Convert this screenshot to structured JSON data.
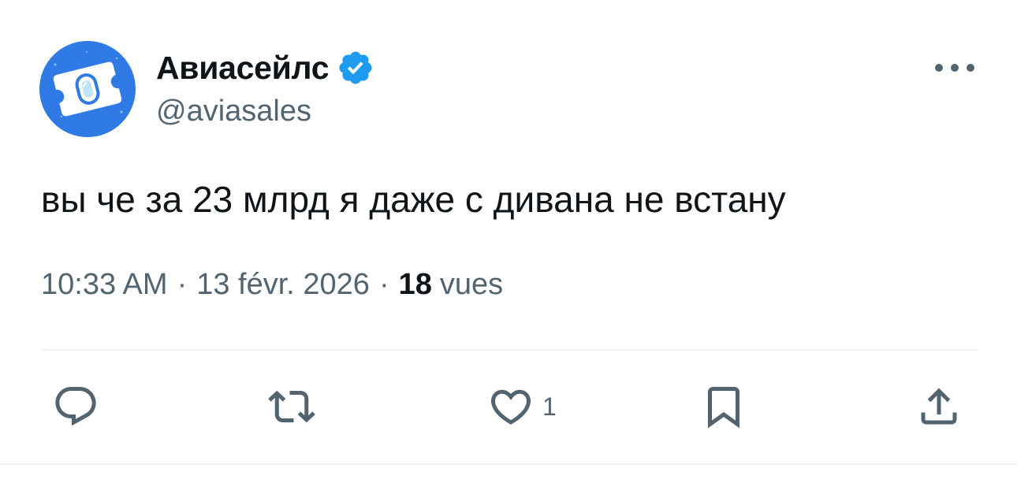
{
  "author": {
    "display_name": "Авиасейлс",
    "handle": "@aviasales",
    "verified": true,
    "avatar_icon": "aviasales-logo-icon",
    "avatar_color": "#2f7ae5",
    "verified_color": "#1d9bf0"
  },
  "tweet": {
    "text": "вы че за 23 млрд я даже с дивана не встану",
    "time": "10:33 AM",
    "date": "13 févr. 2026",
    "separator": "·",
    "views_count": "18",
    "views_label": "vues"
  },
  "actions": {
    "reply": {
      "icon": "reply-icon"
    },
    "retweet": {
      "icon": "retweet-icon"
    },
    "like": {
      "icon": "heart-icon",
      "count": "1"
    },
    "bookmark": {
      "icon": "bookmark-icon"
    },
    "share": {
      "icon": "share-icon"
    }
  },
  "menu": {
    "icon": "more-icon"
  }
}
